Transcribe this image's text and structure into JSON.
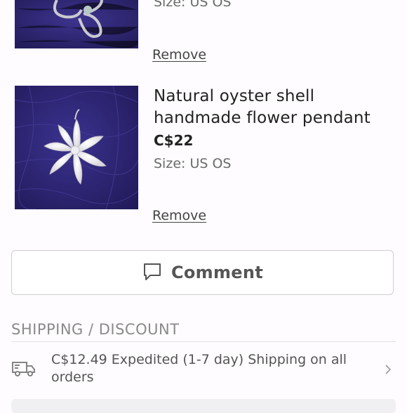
{
  "items": [
    {
      "size": "Size: US OS",
      "remove_label": "Remove"
    },
    {
      "title": "Natural oyster shell handmade flower pendant",
      "price": "C$22",
      "size": "Size: US OS",
      "remove_label": "Remove"
    }
  ],
  "comment": {
    "label": "Comment",
    "icon": "comment-icon"
  },
  "shipping": {
    "header": "SHIPPING / DISCOUNT",
    "text": "C$12.49 Expedited (1-7 day) Shipping on all orders",
    "icon": "truck-icon"
  },
  "colors": {
    "fabric": "#2e2876",
    "text": "#222222",
    "muted": "#6b6b6b"
  }
}
